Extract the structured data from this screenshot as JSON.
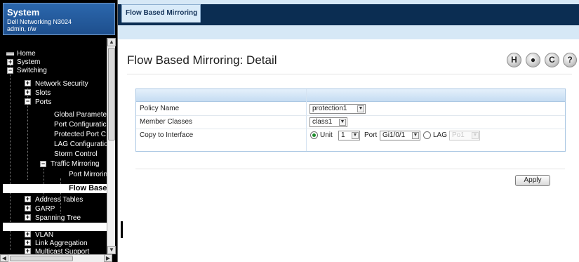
{
  "system": {
    "title": "System",
    "device": "Dell Networking N3024",
    "user": "admin, r/w"
  },
  "nav": {
    "items": [
      {
        "label": "Home",
        "icon": "home-icon"
      },
      {
        "label": "System",
        "icon": "plus-icon"
      },
      {
        "label": "Switching",
        "icon": "minus-icon"
      },
      {
        "label": "Network Security",
        "icon": "plus-icon"
      },
      {
        "label": "Slots",
        "icon": "plus-icon"
      },
      {
        "label": "Ports",
        "icon": "minus-icon"
      },
      {
        "label": "Global Paramete"
      },
      {
        "label": "Port Configuratic"
      },
      {
        "label": "Protected Port C"
      },
      {
        "label": "LAG Configuratio"
      },
      {
        "label": "Storm Control"
      },
      {
        "label": "Traffic Mirroring",
        "icon": "minus-icon"
      },
      {
        "label": "Port Mirrorin"
      },
      {
        "label": "Flow Base",
        "selected": true
      },
      {
        "label": "Address Tables",
        "icon": "plus-icon"
      },
      {
        "label": "GARP",
        "icon": "plus-icon"
      },
      {
        "label": "Spanning Tree",
        "icon": "plus-icon"
      },
      {
        "label": "VLAN",
        "icon": "plus-icon"
      },
      {
        "label": "Link Aggregation",
        "icon": "plus-icon"
      },
      {
        "label": "Multicast Support",
        "icon": "plus-icon"
      }
    ]
  },
  "tabs": {
    "active": "Flow Based Mirroring"
  },
  "page": {
    "title": "Flow Based Mirroring: Detail"
  },
  "toolbar": {
    "save_icon": "H",
    "print_icon": "●",
    "refresh_icon": "C",
    "help_icon": "?"
  },
  "form": {
    "policy_name": {
      "label": "Policy Name",
      "value": "protection1"
    },
    "member_classes": {
      "label": "Member Classes",
      "value": "class1"
    },
    "copy_to": {
      "label": "Copy to Interface",
      "unit_label": "Unit",
      "unit_value": "1",
      "port_label": "Port",
      "port_value": "Gi1/0/1",
      "lag_label": "LAG",
      "lag_value": "Po1",
      "selected": "unit"
    }
  },
  "actions": {
    "apply_label": "Apply"
  }
}
